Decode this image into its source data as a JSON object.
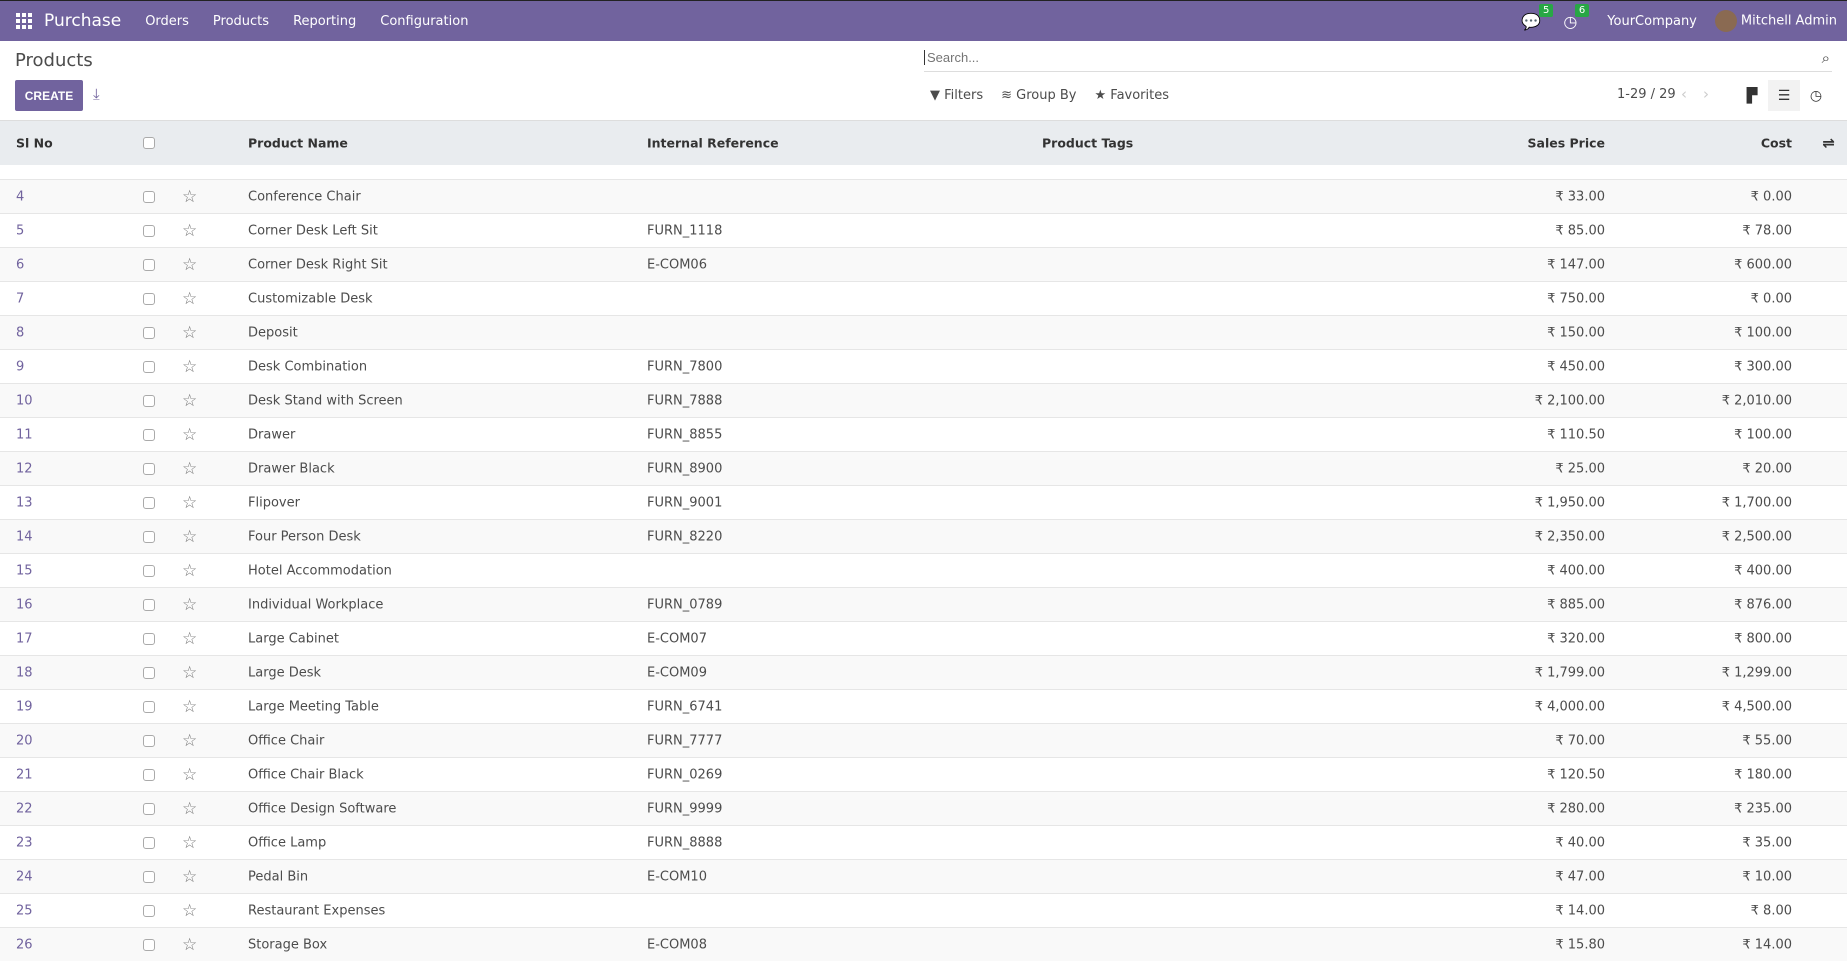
{
  "topbar": {
    "app": "Purchase",
    "menu": [
      "Orders",
      "Products",
      "Reporting",
      "Configuration"
    ],
    "messages_count": "5",
    "activities_count": "6",
    "company": "YourCompany",
    "user": "Mitchell Admin"
  },
  "page": {
    "title": "Products",
    "create_label": "CREATE",
    "search_placeholder": "Search...",
    "filters": "Filters",
    "group_by": "Group By",
    "favorites": "Favorites",
    "pager": "1-29 / 29"
  },
  "columns": {
    "sl": "Sl No",
    "name": "Product Name",
    "ref": "Internal Reference",
    "tags": "Product Tags",
    "price": "Sales Price",
    "cost": "Cost"
  },
  "rows": [
    {
      "sl": "4",
      "name": "Conference Chair",
      "ref": "",
      "price": "₹ 33.00",
      "cost": "₹ 0.00"
    },
    {
      "sl": "5",
      "name": "Corner Desk Left Sit",
      "ref": "FURN_1118",
      "price": "₹ 85.00",
      "cost": "₹ 78.00"
    },
    {
      "sl": "6",
      "name": "Corner Desk Right Sit",
      "ref": "E-COM06",
      "price": "₹ 147.00",
      "cost": "₹ 600.00"
    },
    {
      "sl": "7",
      "name": "Customizable Desk",
      "ref": "",
      "price": "₹ 750.00",
      "cost": "₹ 0.00"
    },
    {
      "sl": "8",
      "name": "Deposit",
      "ref": "",
      "price": "₹ 150.00",
      "cost": "₹ 100.00"
    },
    {
      "sl": "9",
      "name": "Desk Combination",
      "ref": "FURN_7800",
      "price": "₹ 450.00",
      "cost": "₹ 300.00"
    },
    {
      "sl": "10",
      "name": "Desk Stand with Screen",
      "ref": "FURN_7888",
      "price": "₹ 2,100.00",
      "cost": "₹ 2,010.00"
    },
    {
      "sl": "11",
      "name": "Drawer",
      "ref": "FURN_8855",
      "price": "₹ 110.50",
      "cost": "₹ 100.00"
    },
    {
      "sl": "12",
      "name": "Drawer Black",
      "ref": "FURN_8900",
      "price": "₹ 25.00",
      "cost": "₹ 20.00"
    },
    {
      "sl": "13",
      "name": "Flipover",
      "ref": "FURN_9001",
      "price": "₹ 1,950.00",
      "cost": "₹ 1,700.00"
    },
    {
      "sl": "14",
      "name": "Four Person Desk",
      "ref": "FURN_8220",
      "price": "₹ 2,350.00",
      "cost": "₹ 2,500.00"
    },
    {
      "sl": "15",
      "name": "Hotel Accommodation",
      "ref": "",
      "price": "₹ 400.00",
      "cost": "₹ 400.00"
    },
    {
      "sl": "16",
      "name": "Individual Workplace",
      "ref": "FURN_0789",
      "price": "₹ 885.00",
      "cost": "₹ 876.00"
    },
    {
      "sl": "17",
      "name": "Large Cabinet",
      "ref": "E-COM07",
      "price": "₹ 320.00",
      "cost": "₹ 800.00"
    },
    {
      "sl": "18",
      "name": "Large Desk",
      "ref": "E-COM09",
      "price": "₹ 1,799.00",
      "cost": "₹ 1,299.00"
    },
    {
      "sl": "19",
      "name": "Large Meeting Table",
      "ref": "FURN_6741",
      "price": "₹ 4,000.00",
      "cost": "₹ 4,500.00"
    },
    {
      "sl": "20",
      "name": "Office Chair",
      "ref": "FURN_7777",
      "price": "₹ 70.00",
      "cost": "₹ 55.00"
    },
    {
      "sl": "21",
      "name": "Office Chair Black",
      "ref": "FURN_0269",
      "price": "₹ 120.50",
      "cost": "₹ 180.00"
    },
    {
      "sl": "22",
      "name": "Office Design Software",
      "ref": "FURN_9999",
      "price": "₹ 280.00",
      "cost": "₹ 235.00"
    },
    {
      "sl": "23",
      "name": "Office Lamp",
      "ref": "FURN_8888",
      "price": "₹ 40.00",
      "cost": "₹ 35.00"
    },
    {
      "sl": "24",
      "name": "Pedal Bin",
      "ref": "E-COM10",
      "price": "₹ 47.00",
      "cost": "₹ 10.00"
    },
    {
      "sl": "25",
      "name": "Restaurant Expenses",
      "ref": "",
      "price": "₹ 14.00",
      "cost": "₹ 8.00"
    },
    {
      "sl": "26",
      "name": "Storage Box",
      "ref": "E-COM08",
      "price": "₹ 15.80",
      "cost": "₹ 14.00"
    }
  ]
}
